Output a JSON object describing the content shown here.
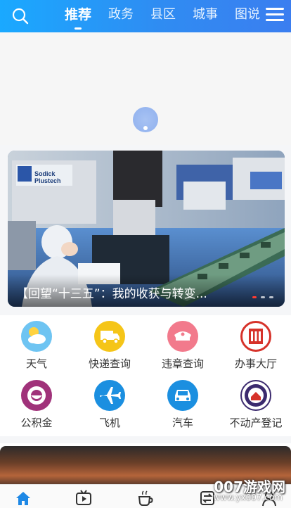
{
  "header": {
    "tabs": [
      {
        "label": "推荐",
        "active": true
      },
      {
        "label": "政务",
        "active": false
      },
      {
        "label": "县区",
        "active": false
      },
      {
        "label": "城事",
        "active": false
      },
      {
        "label": "图说",
        "active": false
      }
    ],
    "search_icon": "search-icon",
    "menu_icon": "hamburger-menu-icon"
  },
  "banner": {
    "title": "【回望“十三五”：我的收获与转变...",
    "slide_count": 3,
    "active_slide": 1,
    "image_text": {
      "machine_brand_line1": "Sodick",
      "machine_brand_line2": "Plustech"
    }
  },
  "services": [
    {
      "label": "天气",
      "icon": "weather-icon",
      "color": "#5ab8f0"
    },
    {
      "label": "快递查询",
      "icon": "express-truck-icon",
      "color": "#f5c518"
    },
    {
      "label": "违章查询",
      "icon": "police-cap-icon",
      "color": "#f27a8c"
    },
    {
      "label": "办事大厅",
      "icon": "service-hall-emblem-icon",
      "color": "#d6322a"
    },
    {
      "label": "公积金",
      "icon": "housing-fund-icon",
      "color": "#a0327a"
    },
    {
      "label": "飞机",
      "icon": "airplane-icon",
      "color": "#1b8fe0"
    },
    {
      "label": "汽车",
      "icon": "car-icon",
      "color": "#1b8fe0"
    },
    {
      "label": "不动产登记",
      "icon": "real-estate-emblem-icon",
      "color": "#3b2a6e"
    }
  ],
  "bottom_nav": [
    {
      "icon": "home-icon",
      "active": true
    },
    {
      "icon": "video-icon",
      "active": false
    },
    {
      "icon": "coffee-cup-icon",
      "active": false
    },
    {
      "icon": "exchange-icon",
      "active": false
    },
    {
      "icon": "user-icon",
      "active": false
    }
  ],
  "watermark": {
    "text": "007游戏网",
    "url": "www.yx007.com"
  },
  "colors": {
    "header_start": "#1aa9ff",
    "header_end": "#3b7ef0",
    "active_dot": "#ff3b30",
    "nav_active": "#1e88e5"
  }
}
